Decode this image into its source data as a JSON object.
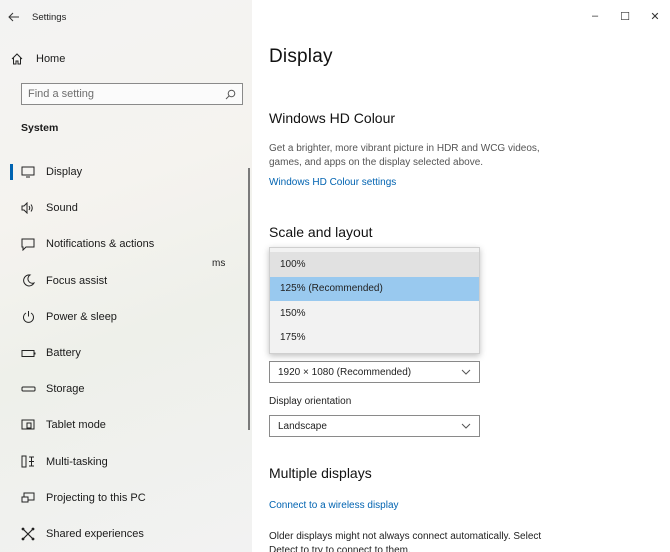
{
  "window": {
    "title": "Settings",
    "controls": {
      "minimize": "–",
      "maximize": "☐",
      "close": "✕"
    }
  },
  "sidebar": {
    "home_label": "Home",
    "search_placeholder": "Find a setting",
    "section_label": "System",
    "items": [
      {
        "label": "Display",
        "icon": "monitor-icon",
        "active": true
      },
      {
        "label": "Sound",
        "icon": "speaker-icon"
      },
      {
        "label": "Notifications & actions",
        "icon": "notification-icon"
      },
      {
        "label": "Focus assist",
        "icon": "moon-icon"
      },
      {
        "label": "Power & sleep",
        "icon": "power-icon"
      },
      {
        "label": "Battery",
        "icon": "battery-icon"
      },
      {
        "label": "Storage",
        "icon": "storage-icon"
      },
      {
        "label": "Tablet mode",
        "icon": "tablet-icon"
      },
      {
        "label": "Multi-tasking",
        "icon": "multitask-icon"
      },
      {
        "label": "Projecting to this PC",
        "icon": "projector-icon"
      },
      {
        "label": "Shared experiences",
        "icon": "shared-icon"
      }
    ]
  },
  "main": {
    "title": "Display",
    "hd_colour": {
      "heading": "Windows HD Colour",
      "description_line1": "Get a brighter, more vibrant picture in HDR and WCG videos,",
      "description_line2": "games, and apps on the display selected above.",
      "link": "Windows HD Colour settings"
    },
    "scale_layout": {
      "heading": "Scale and layout",
      "partial_text": "ms",
      "scale_options": [
        "100%",
        "125% (Recommended)",
        "150%",
        "175%"
      ],
      "selected_scale": "125% (Recommended)",
      "resolution_value": "1920 × 1080 (Recommended)",
      "orientation_label": "Display orientation",
      "orientation_value": "Landscape"
    },
    "multiple_displays": {
      "heading": "Multiple displays",
      "link": "Connect to a wireless display",
      "description_line1": "Older displays might not always connect automatically. Select",
      "description_line2": "Detect to try to connect to them."
    }
  }
}
